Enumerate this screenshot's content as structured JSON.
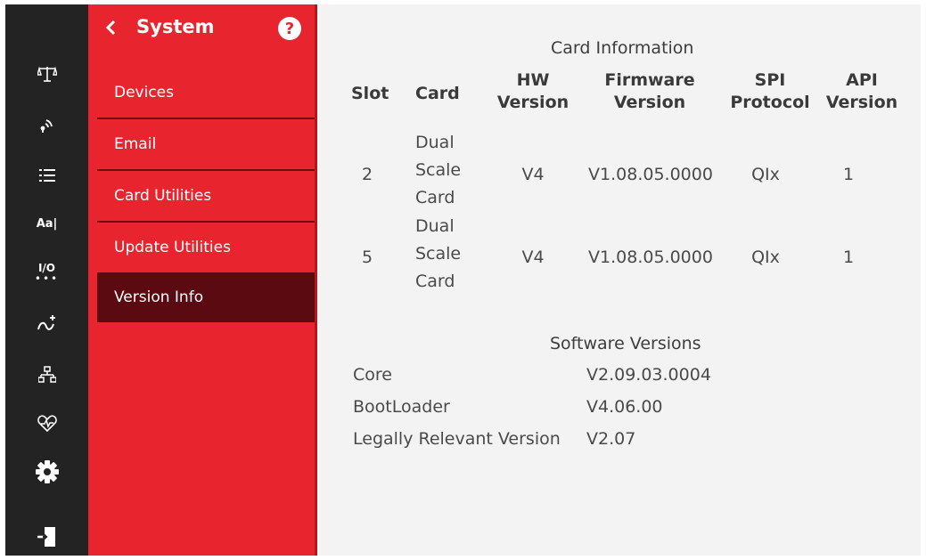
{
  "rail": {
    "icons": [
      {
        "name": "scale-icon"
      },
      {
        "name": "wireless-icon"
      },
      {
        "name": "list-icon"
      },
      {
        "name": "font-format-icon",
        "text": "Aa|"
      },
      {
        "name": "io-icon",
        "text": "I/O"
      },
      {
        "name": "routing-icon"
      },
      {
        "name": "network-icon"
      },
      {
        "name": "health-icon"
      },
      {
        "name": "gear-icon"
      },
      {
        "name": "logout-icon"
      }
    ]
  },
  "nav": {
    "title": "System",
    "back_icon": "chevron-left-icon",
    "help_icon_text": "?",
    "items": [
      {
        "label": "Devices"
      },
      {
        "label": "Email"
      },
      {
        "label": "Card Utilities"
      },
      {
        "label": "Update Utilities"
      },
      {
        "label": "Version Info",
        "active": true
      }
    ]
  },
  "card_info": {
    "title": "Card Information",
    "headers": {
      "slot": "Slot",
      "card": "Card",
      "hw": [
        "HW",
        "Version"
      ],
      "fw": [
        "Firmware",
        "Version"
      ],
      "spi": [
        "SPI",
        "Protocol"
      ],
      "api": [
        "API",
        "Version"
      ]
    },
    "rows": [
      {
        "slot": "2",
        "card": [
          "Dual",
          "Scale",
          "Card"
        ],
        "hw": "V4",
        "fw": "V1.08.05.0000",
        "spi": "QIx",
        "api": "1"
      },
      {
        "slot": "5",
        "card": [
          "Dual",
          "Scale",
          "Card"
        ],
        "hw": "V4",
        "fw": "V1.08.05.0000",
        "spi": "QIx",
        "api": "1"
      }
    ]
  },
  "software": {
    "title": "Software Versions",
    "rows": [
      {
        "label": "Core",
        "value": "V2.09.03.0004"
      },
      {
        "label": "BootLoader",
        "value": "V4.06.00"
      },
      {
        "label": "Legally Relevant Version",
        "value": "V2.07"
      }
    ]
  },
  "colors": {
    "nav_red": "#e8252f",
    "nav_active": "#5c0a11",
    "rail_dark": "#232323",
    "content_bg": "#f4f3f3"
  }
}
